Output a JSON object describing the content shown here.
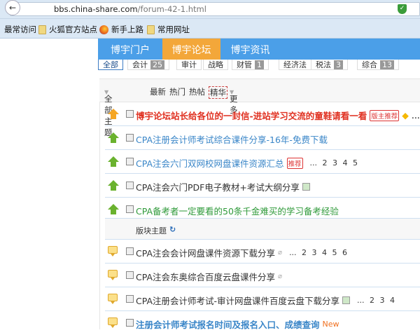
{
  "browser": {
    "url_domain": "bbs.china-share.com",
    "url_path": "/forum-42-1.html",
    "bookmarks": [
      "最常访问",
      "火狐官方站点",
      "新手上路",
      "常用网址"
    ]
  },
  "nav": {
    "items": [
      "博宇门户",
      "博宇论坛",
      "博宇资讯"
    ],
    "active": 1
  },
  "categories": [
    {
      "label": "全部",
      "count": ""
    },
    {
      "label": "会计",
      "count": "25"
    },
    {
      "label": "审计",
      "count": ""
    },
    {
      "label": "战略",
      "count": ""
    },
    {
      "label": "财管",
      "count": "1"
    },
    {
      "label": "经济法",
      "count": ""
    },
    {
      "label": "税法",
      "count": "3"
    },
    {
      "label": "综合",
      "count": "13"
    }
  ],
  "filter": {
    "all_topics": "全部主题",
    "latest": "最新",
    "hot": "热门",
    "hot_posts": "热帖",
    "digest": "精华",
    "more": "更多"
  },
  "pinned": [
    {
      "title": "博宇论坛站长给各位的一封信-进站学习交流的童鞋请看一看",
      "tag": "版主推荐",
      "pages": "..."
    },
    {
      "title": "CPA注册会计师考试综合课件分享-16年-免费下载"
    },
    {
      "title": "CPA注会六门双网校网盘课件资源汇总",
      "tag": "推荐",
      "pages": "... 2 3 4 5"
    },
    {
      "title": "CPA注会六门PDF电子教材+考试大纲分享"
    },
    {
      "title": "CPA备考者一定要看的50条千金难买的学习备考经验"
    }
  ],
  "section": {
    "label": "版块主题"
  },
  "threads": [
    {
      "title": "CPA注会会计网盘课件资源下载分享",
      "pages": "... 2 3 4 5 6"
    },
    {
      "title": "CPA注会东奥综合百度云盘课件分享"
    },
    {
      "title": "CPA注册会计师考试-审计网盘课件百度云盘下载分享",
      "pages": "... 2 3 4"
    },
    {
      "title": "注册会计师考试报名时间及报名入口、成绩查询",
      "badge": "New"
    }
  ],
  "colors": {
    "nav": "#4b9fe8",
    "nav_active": "#f3a73a",
    "red_title": "#e03020",
    "blue_title": "#3a86c8",
    "green_title": "#2f9a3a"
  }
}
